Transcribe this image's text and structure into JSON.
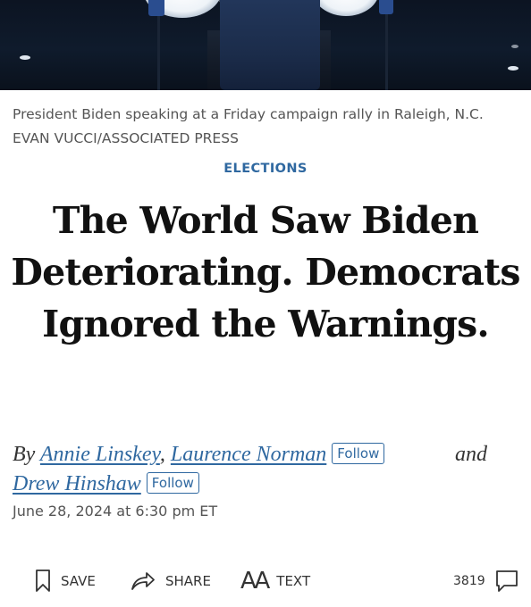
{
  "photo": {
    "caption": "President Biden speaking at a Friday campaign rally in Raleigh, N.C. EVAN VUCCI/ASSOCIATED PRESS"
  },
  "article": {
    "section": "ELECTIONS",
    "headline": "The World Saw Biden Deteriorating. Democrats Ignored the Warnings.",
    "byline_prefix": "By",
    "authors": [
      {
        "name": "Annie Linskey",
        "separator": ","
      },
      {
        "name": "Laurence Norman",
        "follow_label": "Follow"
      },
      {
        "name": "Drew Hinshaw",
        "follow_label": "Follow"
      }
    ],
    "conjunction": "and",
    "date": "June 28, 2024 at 6:30 pm ET"
  },
  "toolbar": {
    "save_label": "SAVE",
    "share_label": "SHARE",
    "text_label": "TEXT",
    "text_icon_glyph": "AA",
    "comment_count": "3819",
    "icons": [
      "bookmark-icon",
      "share-arrow-icon",
      "text-size-icon",
      "comment-bubble-icon"
    ]
  },
  "colors": {
    "accent": "#2f68a0",
    "headline": "#111111",
    "muted": "#555555"
  }
}
